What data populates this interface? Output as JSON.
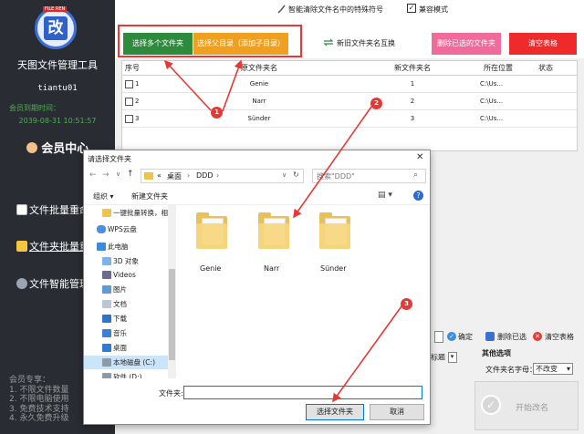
{
  "app": {
    "logo_tag": "FILE REN",
    "logo_char": "改",
    "name": "天图文件管理工具",
    "user": "tiantu01",
    "member_label": "会员到期时间：",
    "member_date": "2039-08-31 10:51:57",
    "member_center": "会员中心"
  },
  "sidebar": {
    "items": [
      {
        "label": "文件批量重命名"
      },
      {
        "label": "文件夹批量重命名"
      },
      {
        "label": "文件智能管理"
      }
    ],
    "footer": [
      "会员专享：",
      "1. 不限文件数量",
      "2. 不限电脑使用",
      "3. 免费技术支持",
      "4. 永久免费升级"
    ]
  },
  "topbar": {
    "title": "智能清除文件名中的特殊符号",
    "compat_label": "兼容模式",
    "compat_checked": true
  },
  "toolbar": {
    "select_multiple": "选择多个文件夹",
    "select_dir": "选择父目录（添加子目录）",
    "swap": "新旧文件夹名互换",
    "delete_selected": "删除已选的文件夹",
    "clear_table": "清空表格"
  },
  "table": {
    "headers": [
      "序号",
      "原文件夹名",
      "新文件夹名",
      "所在位置",
      "状态"
    ],
    "rows": [
      {
        "no": "1",
        "old": "Genie",
        "new": "1",
        "loc": "C:\\Us..."
      },
      {
        "no": "2",
        "old": "Narr",
        "new": "2",
        "loc": "C:\\Us..."
      },
      {
        "no": "3",
        "old": "Sünder",
        "new": "3",
        "loc": "C:\\Us..."
      }
    ]
  },
  "dialog": {
    "title": "请选择文件夹",
    "breadcrumb": [
      "«",
      "桌面",
      "DDD"
    ],
    "search_placeholder": "搜索\"DDD\"",
    "organize": "组织",
    "new_folder": "新建文件夹",
    "tree": [
      {
        "label": "一键批量转换，相",
        "type": "folder"
      },
      {
        "label": "WPS云盘",
        "type": "cloud"
      },
      {
        "label": "此电脑",
        "type": "pc"
      },
      {
        "label": "3D 对象",
        "type": "obj"
      },
      {
        "label": "Videos",
        "type": "video"
      },
      {
        "label": "图片",
        "type": "pic"
      },
      {
        "label": "文档",
        "type": "doc"
      },
      {
        "label": "下载",
        "type": "down"
      },
      {
        "label": "音乐",
        "type": "music"
      },
      {
        "label": "桌面",
        "type": "desk"
      },
      {
        "label": "本地磁盘 (C:)",
        "type": "disk"
      },
      {
        "label": "软件 (D:)",
        "type": "disk"
      }
    ],
    "folders": [
      "Genie",
      "Narr",
      "Sünder"
    ],
    "folder_label": "文件夹:",
    "select_button": "选择文件夹",
    "cancel_button": "取消"
  },
  "right_panel": {
    "confirm": "确定",
    "delete_selected": "删除已选",
    "clear": "清空表格",
    "other_options": "其他选项",
    "folder_case_label": "文件夹名字母：",
    "folder_case_value": "不改变",
    "start_button": "开始改名",
    "partial_title_text": "标题"
  },
  "annotations": [
    "1",
    "2",
    "3"
  ],
  "colors": {
    "green": "#2e8b3d",
    "orange": "#f0a020",
    "pink": "#f06a9a",
    "red": "#ee2a2a",
    "sidebar": "#2a2c33",
    "annotation": "#e53935"
  }
}
